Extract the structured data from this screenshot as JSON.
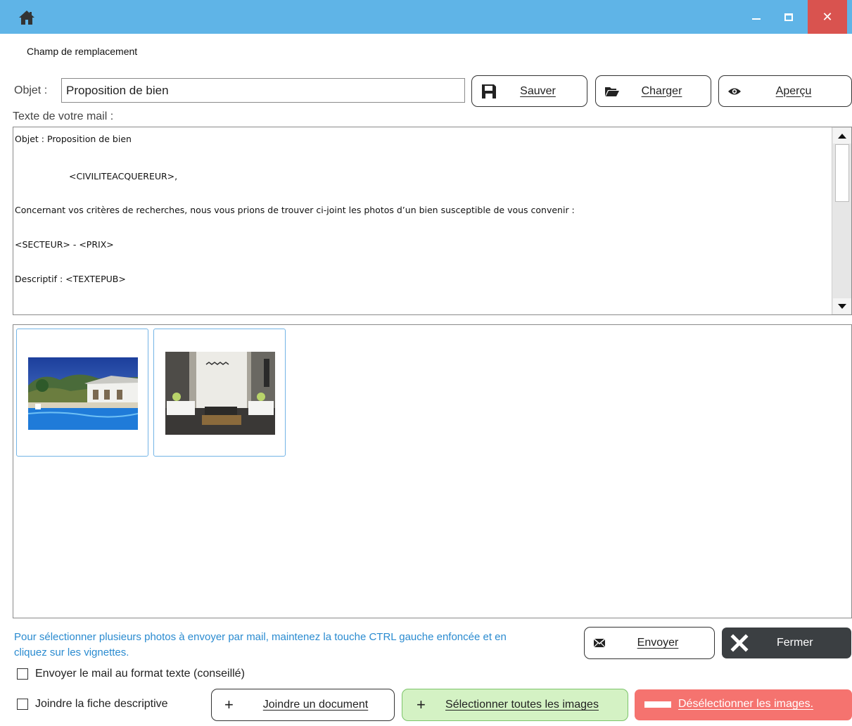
{
  "window": {
    "icon": "home-icon",
    "minimize_icon": "minimize-icon",
    "maximize_icon": "maximize-icon",
    "close_glyph": "✕",
    "title_bar_color": "#5fb4e7",
    "close_color": "#d9534f"
  },
  "menu": {
    "replacement_field": "Champ de remplacement"
  },
  "subject": {
    "label": "Objet :",
    "value": "Proposition de bien"
  },
  "toolbar": {
    "save_label": "Sauver",
    "save_icon": "floppy-disk-icon",
    "load_label": "Charger",
    "load_icon": "folder-open-icon",
    "preview_label": "Aperçu",
    "preview_icon": "eye-icon"
  },
  "mail": {
    "label": "Texte de votre mail :",
    "lines": [
      "Objet : Proposition de bien",
      "<CIVILITEACQUEREUR>,",
      "Concernant vos critères de recherches, nous vous prions de trouver ci-joint les photos d’un bien susceptible de vous convenir :",
      "<SECTEUR> - <PRIX>",
      "Descriptif : <TEXTEPUB>"
    ]
  },
  "photos": [
    {
      "subject": "villa-with-pool-photo"
    },
    {
      "subject": "living-room-photo"
    }
  ],
  "help_text": "Pour sélectionner plusieurs photos à envoyer par mail, maintenez la touche CTRL gauche enfoncée et en cliquez sur les vignettes.",
  "actions": {
    "send_label": "Envoyer",
    "send_icon": "envelope-icon",
    "close_label": "Fermer",
    "close_icon": "x-icon",
    "text_format_label": "Envoyer le mail au format texte (conseillé)",
    "text_format_checked": false,
    "attach_sheet_label": "Joindre la fiche descriptive",
    "attach_sheet_checked": false,
    "join_doc_label": "Joindre un document",
    "join_doc_glyph": "+",
    "select_all_label": "Sélectionner toutes les images",
    "select_all_glyph": "+",
    "deselect_label": "Désélectionner les images.",
    "accent_help": "#2a8bd0",
    "select_all_color": "#d4f2c4",
    "deselect_color": "#f5736f",
    "close_button_color": "#3b3f42"
  }
}
